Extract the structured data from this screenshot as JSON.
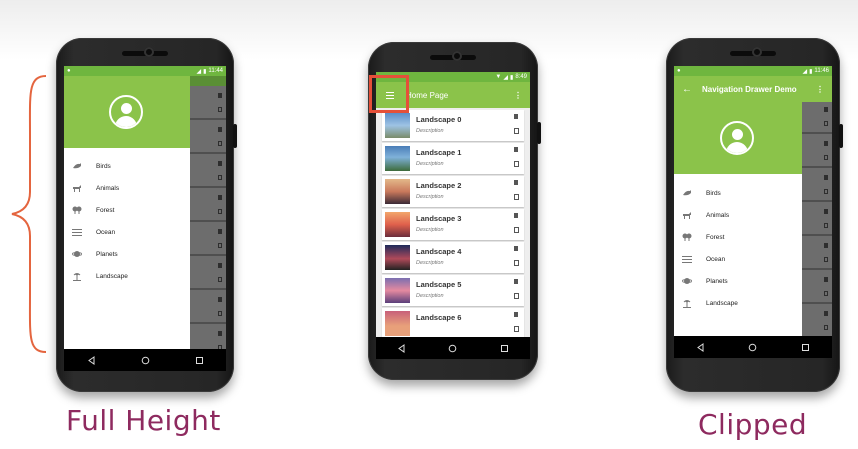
{
  "captions": {
    "left": "Full Height",
    "right": "Clipped"
  },
  "colors": {
    "primary": "#8bc34a",
    "primary_dark": "#6fb63f",
    "caption": "#8e2a5f",
    "highlight": "#e55039",
    "bracket": "#e4653f"
  },
  "phone_left": {
    "status_time": "11:44",
    "drawer_items": [
      {
        "label": "Birds",
        "icon": "bird-icon"
      },
      {
        "label": "Animals",
        "icon": "animal-icon"
      },
      {
        "label": "Forest",
        "icon": "forest-icon"
      },
      {
        "label": "Ocean",
        "icon": "ocean-icon"
      },
      {
        "label": "Planets",
        "icon": "planet-icon"
      },
      {
        "label": "Landscape",
        "icon": "landscape-icon"
      }
    ]
  },
  "phone_center": {
    "status_time": "8:49",
    "appbar_title": "Home Page",
    "list_items": [
      {
        "title": "Landscape 0",
        "desc": "Description"
      },
      {
        "title": "Landscape 1",
        "desc": "Description"
      },
      {
        "title": "Landscape 2",
        "desc": "Description"
      },
      {
        "title": "Landscape 3",
        "desc": "Description"
      },
      {
        "title": "Landscape 4",
        "desc": "Description"
      },
      {
        "title": "Landscape 5",
        "desc": "Description"
      },
      {
        "title": "Landscape 6",
        "desc": ""
      }
    ]
  },
  "phone_right": {
    "status_time": "11:46",
    "appbar_title": "Navigation Drawer Demo",
    "drawer_items": [
      {
        "label": "Birds",
        "icon": "bird-icon"
      },
      {
        "label": "Animals",
        "icon": "animal-icon"
      },
      {
        "label": "Forest",
        "icon": "forest-icon"
      },
      {
        "label": "Ocean",
        "icon": "ocean-icon"
      },
      {
        "label": "Planets",
        "icon": "planet-icon"
      },
      {
        "label": "Landscape",
        "icon": "landscape-icon"
      }
    ]
  }
}
